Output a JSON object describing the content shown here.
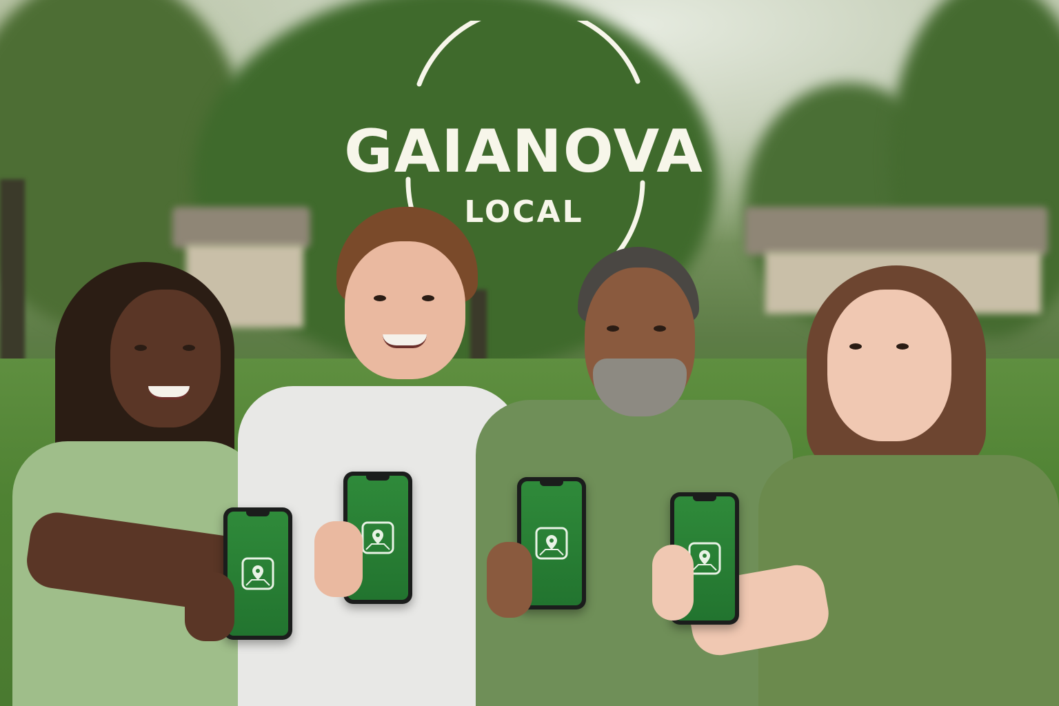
{
  "logo": {
    "title": "GAIANOVA",
    "subtitle": "LOCAL"
  },
  "colors": {
    "logo_text": "#f7f6ea",
    "phone_screen": "#2a7f35",
    "app_icon_stroke": "#e9f3e6"
  },
  "people": [
    {
      "shirt_color": "#9fbe8a",
      "app_icon": "map-pin-icon"
    },
    {
      "shirt_color": "#e8e8e6",
      "app_icon": "map-pin-icon"
    },
    {
      "shirt_color": "#6f8f58",
      "app_icon": "map-pin-icon"
    },
    {
      "shirt_color": "#6b8a4d",
      "app_icon": "map-pin-icon"
    }
  ]
}
